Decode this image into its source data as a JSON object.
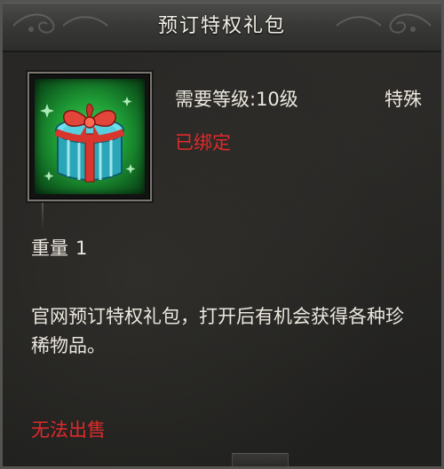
{
  "title": "预订特权礼包",
  "item": {
    "icon": "gift-box-icon",
    "level_requirement": "需要等级:10级",
    "type": "特殊",
    "bound_status": "已绑定",
    "weight_label": "重量",
    "weight_value": "1",
    "description": "官网预订特权礼包，打开后有机会获得各种珍稀物品。",
    "sell_status": "无法出售"
  },
  "colors": {
    "normal_text": "#ece8df",
    "warning_text": "#e02a2a",
    "icon_background": "#2bb344"
  }
}
